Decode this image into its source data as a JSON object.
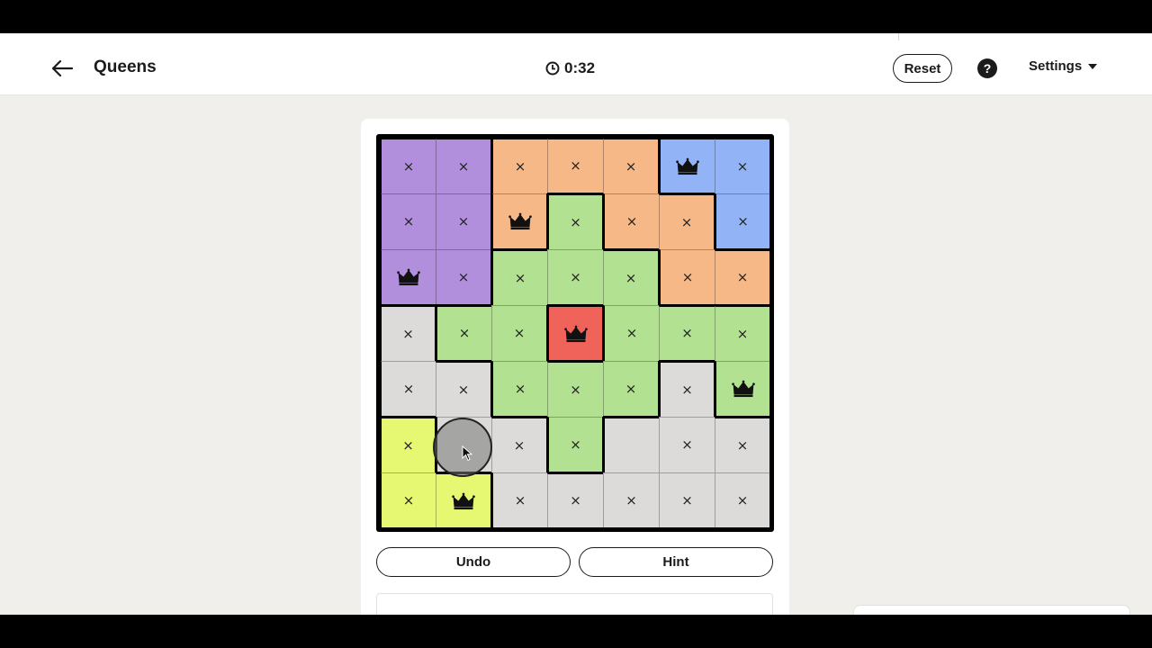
{
  "header": {
    "title": "Queens",
    "timer": "0:32",
    "reset_label": "Reset",
    "help_label": "?",
    "settings_label": "Settings"
  },
  "actions": {
    "undo_label": "Undo",
    "hint_label": "Hint"
  },
  "colors": {
    "purple": "#b18fdd",
    "orange": "#f7b887",
    "blue": "#92b4f7",
    "green": "#b2e191",
    "red": "#f0635a",
    "gray": "#dcdbd9",
    "yellow": "#e6f871"
  },
  "board": {
    "size": 7,
    "marks": {
      "x": "×"
    },
    "regions": [
      [
        "purple",
        "purple",
        "orange",
        "orange",
        "orange",
        "blue",
        "blue"
      ],
      [
        "purple",
        "purple",
        "orange",
        "green",
        "orange",
        "orange",
        "blue"
      ],
      [
        "purple",
        "purple",
        "green",
        "green",
        "green",
        "orange",
        "orange"
      ],
      [
        "gray",
        "green",
        "green",
        "red",
        "green",
        "green",
        "green"
      ],
      [
        "gray",
        "gray",
        "green",
        "green",
        "green",
        "gray",
        "green"
      ],
      [
        "yellow",
        "gray",
        "gray",
        "green",
        "gray",
        "gray",
        "gray"
      ],
      [
        "yellow",
        "yellow",
        "gray",
        "gray",
        "gray",
        "gray",
        "gray"
      ]
    ],
    "cells": [
      [
        "x",
        "x",
        "x",
        "x",
        "x",
        "queen",
        "x"
      ],
      [
        "x",
        "x",
        "queen",
        "x",
        "x",
        "x",
        "x"
      ],
      [
        "queen",
        "x",
        "x",
        "x",
        "x",
        "x",
        "x"
      ],
      [
        "x",
        "x",
        "x",
        "queen",
        "x",
        "x",
        "x"
      ],
      [
        "x",
        "x",
        "x",
        "x",
        "x",
        "x",
        "queen"
      ],
      [
        "x",
        "",
        "x",
        "x",
        "",
        "x",
        "x"
      ],
      [
        "x",
        "queen",
        "x",
        "x",
        "x",
        "x",
        "x"
      ]
    ]
  }
}
